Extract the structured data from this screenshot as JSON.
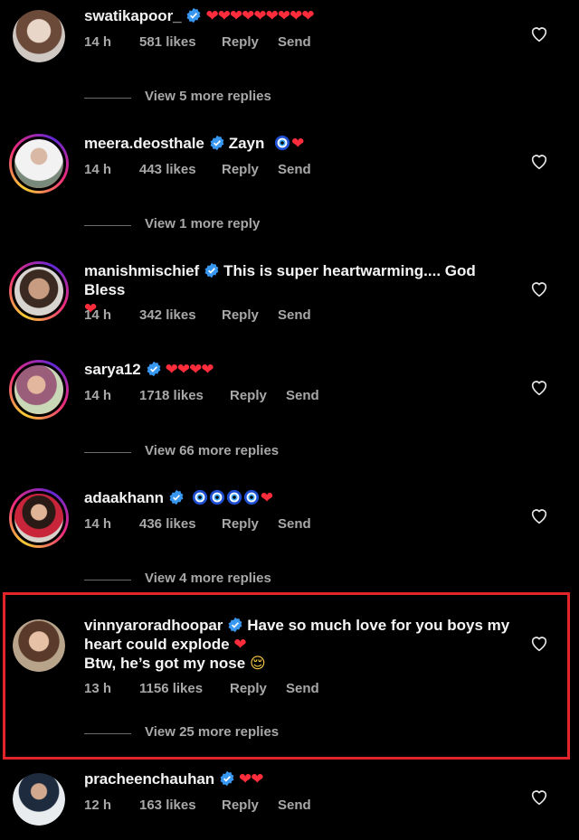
{
  "accent_colors": {
    "heart": "#ff2d3c",
    "verified": "#3897f0",
    "highlight_border": "#e3252b",
    "meta_text": "#a8a8a8"
  },
  "comments": [
    {
      "username": "swatikapoor_",
      "verified": true,
      "body": "",
      "emoji": "❤❤❤❤❤❤❤❤❤",
      "time": "14 h",
      "likes": "581 likes",
      "reply": "Reply",
      "send": "Send",
      "view_replies": "View 5 more replies",
      "avatar_icon": "avatar-photo"
    },
    {
      "username": "meera.deosthale",
      "verified": true,
      "body": "Zayn",
      "emoji": "❤",
      "time": "14 h",
      "likes": "443 likes",
      "reply": "Reply",
      "send": "Send",
      "view_replies": "View 1 more reply",
      "avatar_icon": "avatar-photo"
    },
    {
      "username": "manishmischief",
      "verified": true,
      "body": "This is super heartwarming.... God Bless",
      "emoji": "❤",
      "time": "14 h",
      "likes": "342 likes",
      "reply": "Reply",
      "send": "Send",
      "avatar_icon": "avatar-photo"
    },
    {
      "username": "sarya12",
      "verified": true,
      "body": "",
      "emoji": "❤❤❤❤",
      "time": "14 h",
      "likes": "1718 likes",
      "reply": "Reply",
      "send": "Send",
      "view_replies": "View 66 more replies",
      "avatar_icon": "avatar-photo"
    },
    {
      "username": "adaakhann",
      "verified": true,
      "body": "",
      "emoji": "❤",
      "time": "14 h",
      "likes": "436 likes",
      "reply": "Reply",
      "send": "Send",
      "view_replies": "View 4 more replies",
      "avatar_icon": "avatar-photo"
    },
    {
      "username": "vinnyaroradhoopar",
      "verified": true,
      "body": "Have so much love for you boys my",
      "body_line2": "heart could explode",
      "emoji": "❤",
      "body_line3": "Btw, he’s got my nose",
      "emoji_line3": "😌",
      "time": "13 h",
      "likes": "1156 likes",
      "reply": "Reply",
      "send": "Send",
      "view_replies": "View 25 more replies",
      "avatar_icon": "avatar-photo"
    },
    {
      "username": "pracheenchauhan",
      "verified": true,
      "body": "",
      "emoji": "❤❤",
      "time": "12 h",
      "likes": "163 likes",
      "reply": "Reply",
      "send": "Send",
      "avatar_icon": "avatar-photo"
    }
  ]
}
